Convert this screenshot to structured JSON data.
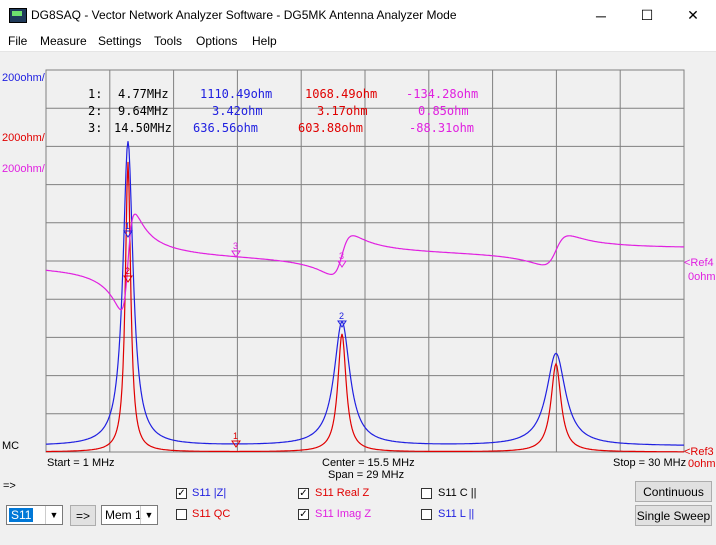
{
  "window": {
    "title": "DG8SAQ  -  Vector Network Analyzer Software - DG5MK Antenna Analyzer Mode",
    "minimize_glyph": "─",
    "maximize_glyph": "☐",
    "close_glyph": "✕"
  },
  "menu": [
    "File",
    "Measure",
    "Settings",
    "Tools",
    "Options",
    "Help"
  ],
  "plot": {
    "scale_labels": [
      "200ohm/",
      "200ohm/",
      "200ohm/"
    ],
    "ref_labels": [
      {
        "text": "<Ref4",
        "sub": "0ohm",
        "color": "#e020e0"
      },
      {
        "text": "<Ref3",
        "sub": "0ohm",
        "color": "#e00000"
      }
    ],
    "mc_label": "MC",
    "start": "Start = 1 MHz",
    "center": "Center = 15.5 MHz",
    "span": "Span = 29 MHz",
    "stop": "Stop = 30 MHz",
    "markers": [
      {
        "id": "1:",
        "freq": "4.77MHz",
        "z": "1110.49ohm",
        "r": "1068.49ohm",
        "x": "-134.28ohm"
      },
      {
        "id": "2:",
        "freq": "9.64MHz",
        "z": "3.42ohm",
        "r": "3.17ohm",
        "x": "0.85ohm"
      },
      {
        "id": "3:",
        "freq": "14.50MHz",
        "z": "636.56ohm",
        "r": "603.88ohm",
        "x": "-88.31ohm"
      }
    ],
    "marker_nums": [
      "1",
      "2",
      "3",
      "1",
      "2",
      "3"
    ],
    "colors": {
      "z": "#2020e0",
      "r": "#e00000",
      "x": "#e020e0",
      "grid": "#808080"
    }
  },
  "controls": {
    "arrow_label": "=>",
    "source_select": "S11",
    "go_button": "=>",
    "mem_select": "Mem 1",
    "traces": [
      {
        "checked": true,
        "label": "S11  |Z|",
        "color": "#2020e0"
      },
      {
        "checked": true,
        "label": "S11  Real Z",
        "color": "#e00000"
      },
      {
        "checked": false,
        "label": "S11   C ||",
        "color": "#000000"
      },
      {
        "checked": false,
        "label": "S11  QC",
        "color": "#e00000"
      },
      {
        "checked": true,
        "label": "S11  Imag Z",
        "color": "#e020e0"
      },
      {
        "checked": false,
        "label": "S11   L ||",
        "color": "#2020e0"
      }
    ],
    "continuous": "Continuous",
    "single_sweep": "Single Sweep",
    "check_glyph": "✓"
  }
}
